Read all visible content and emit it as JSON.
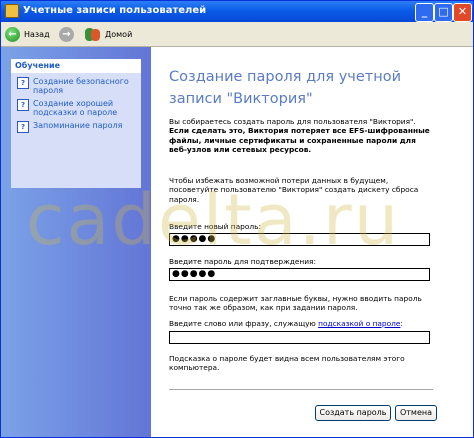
{
  "window": {
    "title": "Учетные записи пользователей",
    "controls": [
      "_",
      "□",
      "✕"
    ]
  },
  "toolbar": {
    "back_label": "Назад",
    "home_label": "Домой"
  },
  "sidebar": {
    "panel_title": "Обучение",
    "items": [
      {
        "label": "Создание безопасного пароля"
      },
      {
        "label": "Создание хорошей подсказки о пароле"
      },
      {
        "label": "Запоминание пароля"
      }
    ]
  },
  "main": {
    "heading": "Создание пароля для учетной записи \"Виктория\"",
    "warning_intro": "Вы собираетесь создать пароль для пользователя \"Виктория\".",
    "warning_bold": "Если сделать это, Виктория потеряет все EFS-шифрованные файлы, личные сертификаты и сохраненные пароли для веб-узлов или сетевых ресурсов.",
    "advice": "Чтобы избежать возможной потери данных в будущем, посоветуйте пользователю \"Виктория\" создать дискету сброса пароля.",
    "new_password_label": "Введите новый пароль:",
    "new_password_value": "●●●●●",
    "confirm_label": "Введите пароль для подтверждения:",
    "confirm_value": "●●●●●",
    "caps_note": "Если пароль содержит заглавные буквы, нужно вводить пароль точно так же образом, как при задании пароля.",
    "hint_label_prefix": "Введите слово или фразу, служащую ",
    "hint_link": "подсказкой о пароле",
    "hint_label_suffix": ":",
    "hint_value": "",
    "hint_note": "Подсказка о пароле будет видна всем пользователям этого компьютера.",
    "create_button": "Создать пароль",
    "cancel_button": "Отмена"
  },
  "watermark": "cadelta.ru"
}
